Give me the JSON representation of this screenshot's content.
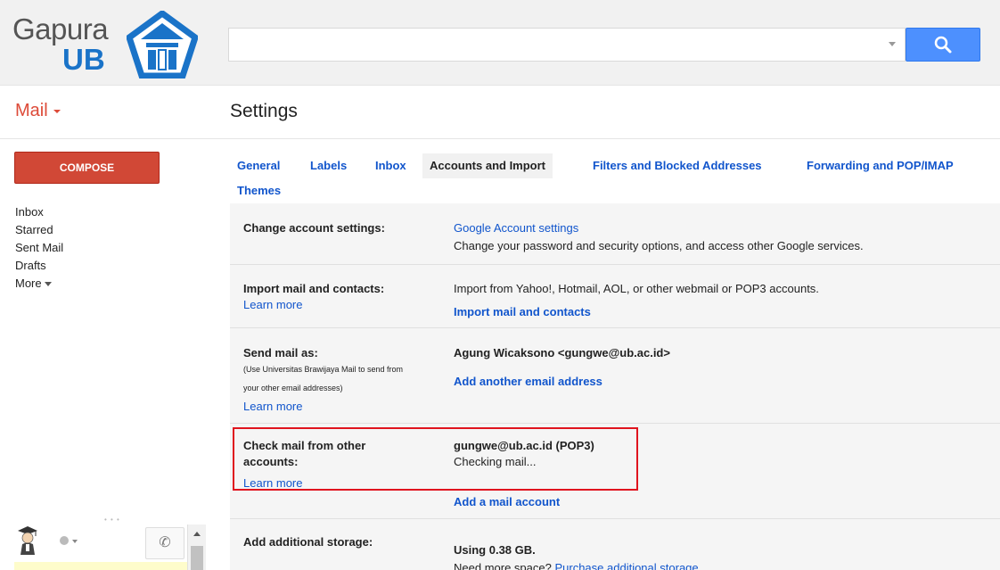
{
  "logo": {
    "line1": "Gapura",
    "line2": "UB"
  },
  "search": {
    "placeholder": ""
  },
  "header": {
    "app_label": "Mail",
    "page_title": "Settings"
  },
  "compose_label": "COMPOSE",
  "nav": [
    "Inbox",
    "Starred",
    "Sent Mail",
    "Drafts",
    "More"
  ],
  "tabs": [
    {
      "label": "General",
      "active": false
    },
    {
      "label": "Labels",
      "active": false
    },
    {
      "label": "Inbox",
      "active": false
    },
    {
      "label": "Accounts and Import",
      "active": true
    },
    {
      "label": "Filters and Blocked Addresses",
      "active": false
    },
    {
      "label": "Forwarding and POP/IMAP",
      "active": false
    },
    {
      "label": "Themes",
      "active": false
    }
  ],
  "sections": {
    "change_account": {
      "label": "Change account settings:",
      "link": "Google Account settings",
      "desc": "Change your password and security options, and access other Google services."
    },
    "import": {
      "label": "Import mail and contacts:",
      "learn_more": "Learn more",
      "desc": "Import from Yahoo!, Hotmail, AOL, or other webmail or POP3 accounts.",
      "action": "Import mail and contacts"
    },
    "send_as": {
      "label": "Send mail as:",
      "sub_line1": "(Use Universitas Brawijaya Mail to send from",
      "sub_line2": "your other email addresses)",
      "learn_more": "Learn more",
      "address": "Agung Wicaksono <gungwe@ub.ac.id>",
      "action": "Add another email address"
    },
    "check_mail": {
      "label_line1": "Check mail from other",
      "label_line2": "accounts:",
      "learn_more": "Learn more",
      "account": "gungwe@ub.ac.id (POP3)",
      "status": "Checking mail...",
      "action": "Add a mail account"
    },
    "storage": {
      "label": "Add additional storage:",
      "usage": "Using 0.38 GB.",
      "need_more": "Need more space?",
      "purchase": "Purchase additional storage"
    }
  },
  "colors": {
    "accent_red": "#dd4b39",
    "compose_red": "#d14836",
    "link_blue": "#1155cc",
    "search_blue": "#4d90fe",
    "highlight_box": "#e0141e"
  }
}
